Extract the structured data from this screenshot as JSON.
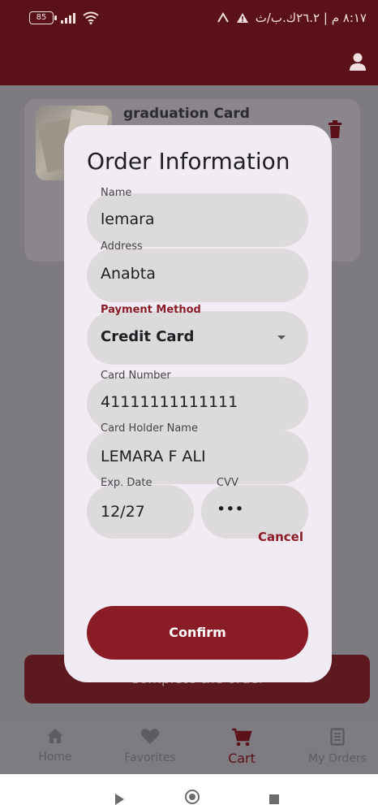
{
  "status_bar": {
    "battery": "85",
    "time_text": "٨:١٧ م | ٢٦.٢ك.ب/ث"
  },
  "cart": {
    "item_title": "graduation Card",
    "complete_order_label": "Complete the order"
  },
  "dialog": {
    "title": "Order Information",
    "name_label": "Name",
    "name_value": "lemara",
    "address_label": "Address",
    "address_value": "Anabta",
    "payment_label": "Payment Method",
    "payment_value": "Credit Card",
    "card_number_label": "Card Number",
    "card_number_value": "41111111111111",
    "card_holder_label": "Card Holder Name",
    "card_holder_value": "LEMARA F ALI",
    "exp_label": "Exp. Date",
    "exp_value": "12/27",
    "cvv_label": "CVV",
    "cvv_value": "•••",
    "cancel_label": "Cancel",
    "confirm_label": "Confirm"
  },
  "bottom_nav": {
    "items": [
      {
        "label": "Home",
        "icon": "home-icon"
      },
      {
        "label": "Favorites",
        "icon": "heart-icon"
      },
      {
        "label": "Cart",
        "icon": "cart-icon"
      },
      {
        "label": "My Orders",
        "icon": "receipt-icon"
      }
    ],
    "active_index": 2
  },
  "colors": {
    "primary": "#8a1c27",
    "app_bar": "#5a1218",
    "dialog_bg": "#f1ecf3",
    "field_bg": "#dcdadb"
  }
}
